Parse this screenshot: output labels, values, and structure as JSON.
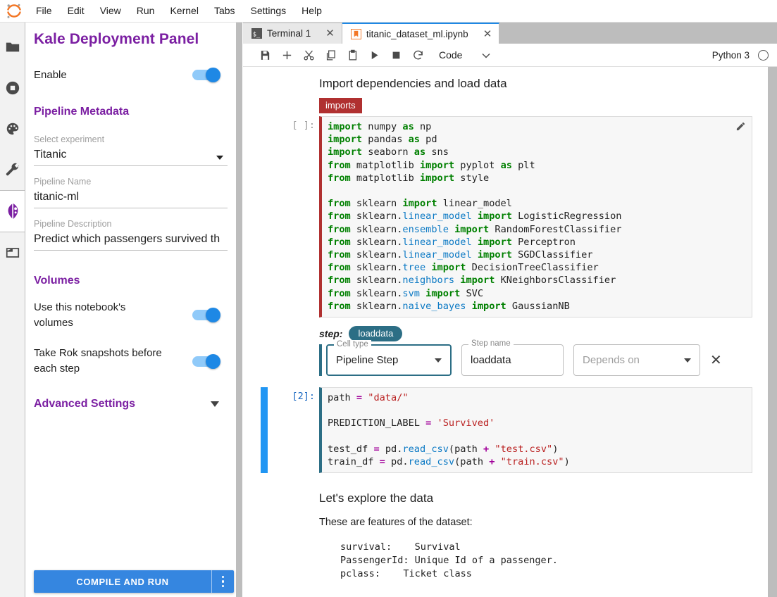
{
  "app": {
    "logo": "jupyter-logo",
    "menu": [
      "File",
      "Edit",
      "View",
      "Run",
      "Kernel",
      "Tabs",
      "Settings",
      "Help"
    ]
  },
  "activitybar": {
    "items": [
      {
        "name": "file-browser-icon",
        "selected": false
      },
      {
        "name": "running-terminals-icon",
        "selected": false
      },
      {
        "name": "palette-icon",
        "selected": false
      },
      {
        "name": "wrench-icon",
        "selected": false
      },
      {
        "name": "kale-icon",
        "selected": true
      },
      {
        "name": "open-tabs-icon",
        "selected": false
      }
    ]
  },
  "kale_panel": {
    "title": "Kale Deployment Panel",
    "enable_label": "Enable",
    "enable_on": true,
    "metadata_heading": "Pipeline Metadata",
    "fields": [
      {
        "caption": "Select experiment",
        "value": "Titanic",
        "type": "select"
      },
      {
        "caption": "Pipeline Name",
        "value": "titanic-ml",
        "type": "text"
      },
      {
        "caption": "Pipeline Description",
        "value": "Predict which passengers survived th",
        "type": "text"
      }
    ],
    "volumes_heading": "Volumes",
    "volume_toggles": [
      {
        "label": "Use this notebook's volumes",
        "on": true
      },
      {
        "label": "Take Rok snapshots before each step",
        "on": true
      }
    ],
    "advanced_heading": "Advanced Settings",
    "compile_label": "COMPILE AND RUN"
  },
  "tabs": [
    {
      "label": "Terminal 1",
      "icon": "terminal-icon",
      "active": false,
      "close": "✕"
    },
    {
      "label": "titanic_dataset_ml.ipynb",
      "icon": "notebook-icon",
      "active": true,
      "close": "✕"
    }
  ],
  "toolbar": {
    "buttons": [
      {
        "name": "save-button",
        "title": "Save"
      },
      {
        "name": "insert-cell-button",
        "title": "Insert"
      },
      {
        "name": "cut-button",
        "title": "Cut"
      },
      {
        "name": "copy-button",
        "title": "Copy"
      },
      {
        "name": "paste-button",
        "title": "Paste"
      },
      {
        "name": "run-button",
        "title": "Run"
      },
      {
        "name": "stop-button",
        "title": "Stop"
      },
      {
        "name": "restart-button",
        "title": "Restart"
      }
    ],
    "cell_type": "Code",
    "kernel_name": "Python 3",
    "kernel_status": "idle"
  },
  "notebook": {
    "heading_1": "Import dependencies and load data",
    "cell_tag": "imports",
    "cell_1": {
      "prompt": "[ ]:",
      "lines": [
        [
          {
            "t": "import",
            "c": "k"
          },
          {
            "t": " numpy ",
            "c": ""
          },
          {
            "t": "as",
            "c": "k"
          },
          {
            "t": " np",
            "c": ""
          }
        ],
        [
          {
            "t": "import",
            "c": "k"
          },
          {
            "t": " pandas ",
            "c": ""
          },
          {
            "t": "as",
            "c": "k"
          },
          {
            "t": " pd",
            "c": ""
          }
        ],
        [
          {
            "t": "import",
            "c": "k"
          },
          {
            "t": " seaborn ",
            "c": ""
          },
          {
            "t": "as",
            "c": "k"
          },
          {
            "t": " sns",
            "c": ""
          }
        ],
        [
          {
            "t": "from",
            "c": "k"
          },
          {
            "t": " matplotlib ",
            "c": ""
          },
          {
            "t": "import",
            "c": "k"
          },
          {
            "t": " pyplot ",
            "c": ""
          },
          {
            "t": "as",
            "c": "k"
          },
          {
            "t": " plt",
            "c": ""
          }
        ],
        [
          {
            "t": "from",
            "c": "k"
          },
          {
            "t": " matplotlib ",
            "c": ""
          },
          {
            "t": "import",
            "c": "k"
          },
          {
            "t": " style",
            "c": ""
          }
        ],
        [],
        [
          {
            "t": "from",
            "c": "k"
          },
          {
            "t": " sklearn ",
            "c": ""
          },
          {
            "t": "import",
            "c": "k"
          },
          {
            "t": " linear_model",
            "c": ""
          }
        ],
        [
          {
            "t": "from",
            "c": "k"
          },
          {
            "t": " sklearn.",
            "c": ""
          },
          {
            "t": "linear_model",
            "c": "mod"
          },
          {
            "t": " ",
            "c": ""
          },
          {
            "t": "import",
            "c": "k"
          },
          {
            "t": " LogisticRegression",
            "c": ""
          }
        ],
        [
          {
            "t": "from",
            "c": "k"
          },
          {
            "t": " sklearn.",
            "c": ""
          },
          {
            "t": "ensemble",
            "c": "mod"
          },
          {
            "t": " ",
            "c": ""
          },
          {
            "t": "import",
            "c": "k"
          },
          {
            "t": " RandomForestClassifier",
            "c": ""
          }
        ],
        [
          {
            "t": "from",
            "c": "k"
          },
          {
            "t": " sklearn.",
            "c": ""
          },
          {
            "t": "linear_model",
            "c": "mod"
          },
          {
            "t": " ",
            "c": ""
          },
          {
            "t": "import",
            "c": "k"
          },
          {
            "t": " Perceptron",
            "c": ""
          }
        ],
        [
          {
            "t": "from",
            "c": "k"
          },
          {
            "t": " sklearn.",
            "c": ""
          },
          {
            "t": "linear_model",
            "c": "mod"
          },
          {
            "t": " ",
            "c": ""
          },
          {
            "t": "import",
            "c": "k"
          },
          {
            "t": " SGDClassifier",
            "c": ""
          }
        ],
        [
          {
            "t": "from",
            "c": "k"
          },
          {
            "t": " sklearn.",
            "c": ""
          },
          {
            "t": "tree",
            "c": "mod"
          },
          {
            "t": " ",
            "c": ""
          },
          {
            "t": "import",
            "c": "k"
          },
          {
            "t": " DecisionTreeClassifier",
            "c": ""
          }
        ],
        [
          {
            "t": "from",
            "c": "k"
          },
          {
            "t": " sklearn.",
            "c": ""
          },
          {
            "t": "neighbors",
            "c": "mod"
          },
          {
            "t": " ",
            "c": ""
          },
          {
            "t": "import",
            "c": "k"
          },
          {
            "t": " KNeighborsClassifier",
            "c": ""
          }
        ],
        [
          {
            "t": "from",
            "c": "k"
          },
          {
            "t": " sklearn.",
            "c": ""
          },
          {
            "t": "svm",
            "c": "mod"
          },
          {
            "t": " ",
            "c": ""
          },
          {
            "t": "import",
            "c": "k"
          },
          {
            "t": " SVC",
            "c": ""
          }
        ],
        [
          {
            "t": "from",
            "c": "k"
          },
          {
            "t": " sklearn.",
            "c": ""
          },
          {
            "t": "naive_bayes",
            "c": "mod"
          },
          {
            "t": " ",
            "c": ""
          },
          {
            "t": "import",
            "c": "k"
          },
          {
            "t": " GaussianNB",
            "c": ""
          }
        ]
      ]
    },
    "step_bar": {
      "step_word": "step:",
      "step_chip": "loaddata",
      "cell_type_legend": "Cell type",
      "cell_type_value": "Pipeline Step",
      "step_name_legend": "Step name",
      "step_name_value": "loaddata",
      "depends_on_placeholder": "Depends on",
      "close": "✕"
    },
    "cell_2": {
      "prompt": "[2]:",
      "lines": [
        [
          {
            "t": "path ",
            "c": ""
          },
          {
            "t": "=",
            "c": "op"
          },
          {
            "t": " ",
            "c": ""
          },
          {
            "t": "\"data/\"",
            "c": "s"
          }
        ],
        [],
        [
          {
            "t": "PREDICTION_LABEL ",
            "c": ""
          },
          {
            "t": "=",
            "c": "op"
          },
          {
            "t": " ",
            "c": ""
          },
          {
            "t": "'Survived'",
            "c": "s"
          }
        ],
        [],
        [
          {
            "t": "test_df ",
            "c": ""
          },
          {
            "t": "=",
            "c": "op"
          },
          {
            "t": " pd.",
            "c": ""
          },
          {
            "t": "read_csv",
            "c": "fn"
          },
          {
            "t": "(path ",
            "c": ""
          },
          {
            "t": "+",
            "c": "op"
          },
          {
            "t": " ",
            "c": ""
          },
          {
            "t": "\"test.csv\"",
            "c": "s"
          },
          {
            "t": ")",
            "c": ""
          }
        ],
        [
          {
            "t": "train_df ",
            "c": ""
          },
          {
            "t": "=",
            "c": "op"
          },
          {
            "t": " pd.",
            "c": ""
          },
          {
            "t": "read_csv",
            "c": "fn"
          },
          {
            "t": "(path ",
            "c": ""
          },
          {
            "t": "+",
            "c": "op"
          },
          {
            "t": " ",
            "c": ""
          },
          {
            "t": "\"train.csv\"",
            "c": "s"
          },
          {
            "t": ")",
            "c": ""
          }
        ]
      ]
    },
    "heading_2": "Let's explore the data",
    "paragraph_2": "These are features of the dataset:",
    "pre_2": "survival:    Survival\nPassengerId: Unique Id of a passenger.\npclass:    Ticket class"
  },
  "colors": {
    "kale_purple": "#7b1fa2",
    "toggle_blue": "#1e88e5",
    "compile_blue": "#3586e0",
    "tag_red": "#b03030",
    "step_teal": "#2c6e85",
    "active_cell_blue": "#2196f3"
  }
}
